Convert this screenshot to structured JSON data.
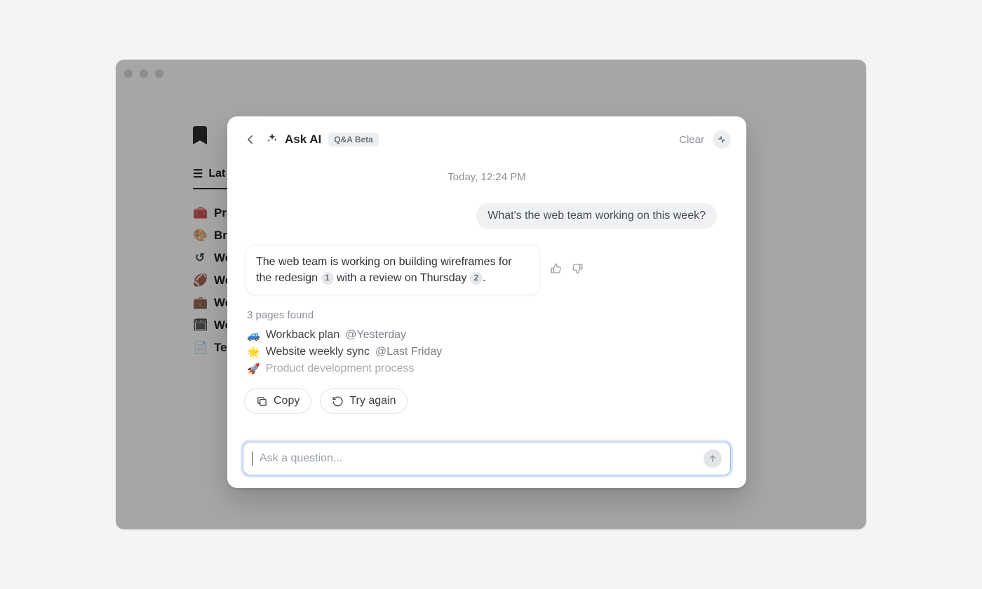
{
  "window": {
    "tab_label": "Lat"
  },
  "sidebar_items": [
    {
      "icon": "🧰",
      "label": "Pro"
    },
    {
      "icon": "🎨",
      "label": "Bra"
    },
    {
      "icon": "↺",
      "label": "We"
    },
    {
      "icon": "🏈",
      "label": "We"
    },
    {
      "icon": "💼",
      "label": "Wo"
    },
    {
      "icon": "🗓",
      "label": "We"
    },
    {
      "icon": "📄",
      "label": "Tec"
    }
  ],
  "modal": {
    "title": "Ask AI",
    "beta": "Q&A Beta",
    "clear": "Clear",
    "timestamp": "Today, 12:24 PM",
    "user_message": "What's the web team working on this week?",
    "ai_message_pre": "The web team is working on building wireframes for the redesign ",
    "ai_cite1": "1",
    "ai_message_mid": " with a review on Thursday ",
    "ai_cite2": "2",
    "ai_message_post": ".",
    "sources_label": "3 pages found",
    "sources": [
      {
        "emoji": "🚙",
        "title": "Workback plan",
        "at": "@Yesterday",
        "faded": false
      },
      {
        "emoji": "🌟",
        "title": "Website weekly sync",
        "at": "@Last Friday",
        "faded": false
      },
      {
        "emoji": "🚀",
        "title": "Product development process",
        "at": "",
        "faded": true
      }
    ],
    "copy": "Copy",
    "try_again": "Try again",
    "placeholder": "Ask a question..."
  }
}
